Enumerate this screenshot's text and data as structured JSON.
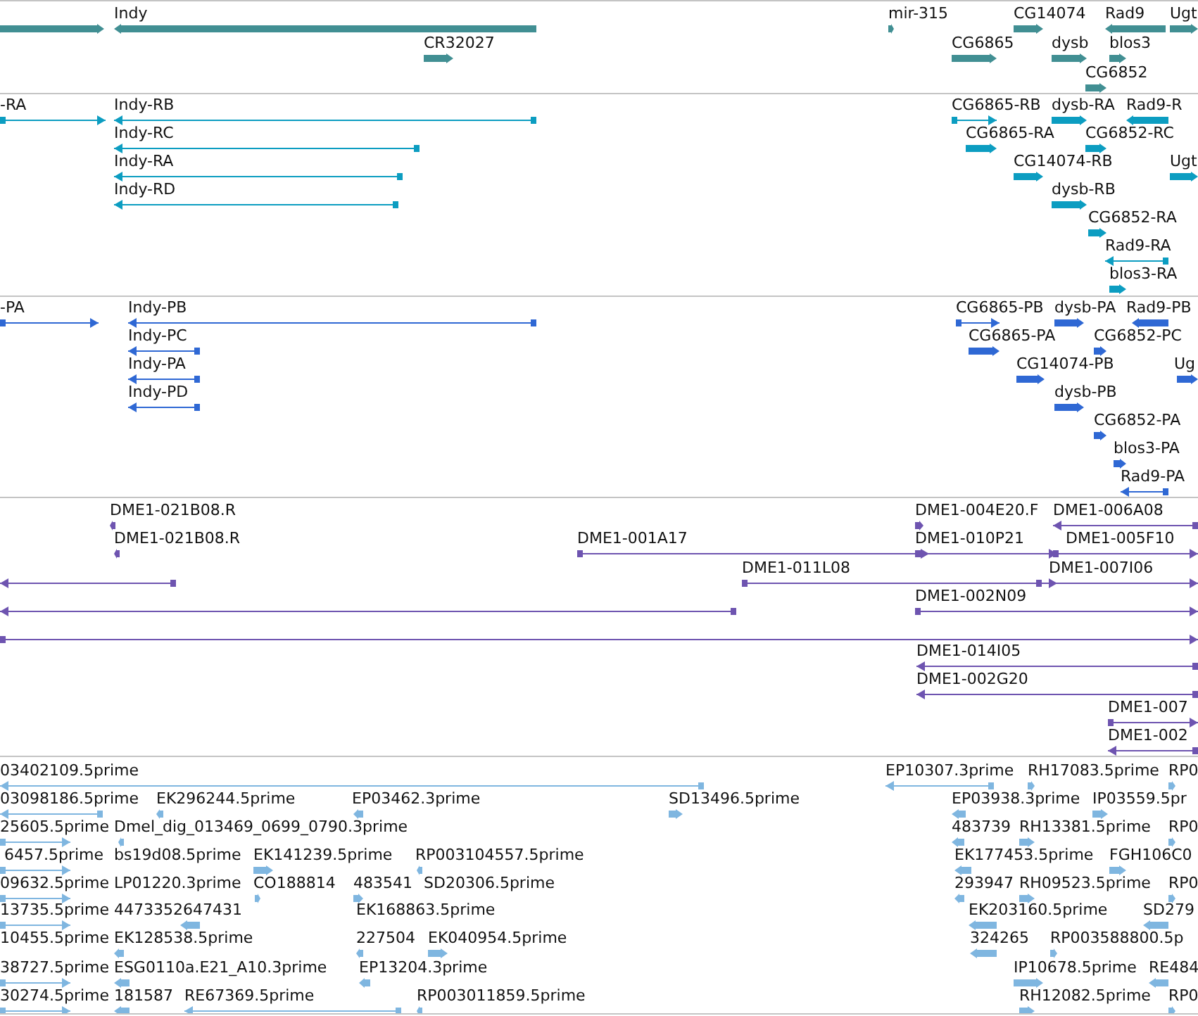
{
  "tracks": [
    {
      "kind": "gene",
      "features": [
        {
          "reverse": false
        },
        {
          "label": "Indy",
          "reverse": true
        },
        {
          "label": "mir-315",
          "reverse": false
        },
        {
          "label": "CG14074",
          "reverse": false
        },
        {
          "label": "Rad9",
          "reverse": true
        },
        {
          "label": "Ugt",
          "reverse": false
        },
        {
          "label": "CR32027",
          "reverse": false
        },
        {
          "label": "CG6865",
          "reverse": false
        },
        {
          "label": "dysb",
          "reverse": false
        },
        {
          "label": "blos3",
          "reverse": false
        },
        {
          "label": "CG6852",
          "reverse": false
        }
      ]
    },
    {
      "kind": "transcript",
      "features": [
        {
          "label": "-RA",
          "reverse": false
        },
        {
          "label": "Indy-RB",
          "reverse": true
        },
        {
          "label": "CG6865-RB",
          "reverse": false
        },
        {
          "label": "dysb-RA",
          "reverse": false
        },
        {
          "label": "Rad9-R",
          "reverse": true
        },
        {
          "label": "Indy-RC",
          "reverse": true
        },
        {
          "label": "CG6865-RA",
          "reverse": false
        },
        {
          "label": "CG6852-RC",
          "reverse": false
        },
        {
          "label": "Indy-RA",
          "reverse": true
        },
        {
          "label": "CG14074-RB",
          "reverse": false
        },
        {
          "label": "Ugt",
          "reverse": false
        },
        {
          "label": "Indy-RD",
          "reverse": true
        },
        {
          "label": "dysb-RB",
          "reverse": false
        },
        {
          "label": "CG6852-RA",
          "reverse": false
        },
        {
          "label": "Rad9-RA",
          "reverse": true
        },
        {
          "label": "blos3-RA",
          "reverse": false
        }
      ]
    },
    {
      "kind": "protein",
      "features": [
        {
          "label": "-PA",
          "reverse": false
        },
        {
          "label": "Indy-PB",
          "reverse": true
        },
        {
          "label": "CG6865-PB",
          "reverse": false
        },
        {
          "label": "dysb-PA",
          "reverse": false
        },
        {
          "label": "Rad9-PB",
          "reverse": true
        },
        {
          "label": "Indy-PC",
          "reverse": true
        },
        {
          "label": "CG6865-PA",
          "reverse": false
        },
        {
          "label": "CG6852-PC",
          "reverse": false
        },
        {
          "label": "Indy-PA",
          "reverse": true
        },
        {
          "label": "CG14074-PB",
          "reverse": false
        },
        {
          "label": "Ug",
          "reverse": false
        },
        {
          "label": "Indy-PD",
          "reverse": true
        },
        {
          "label": "dysb-PB",
          "reverse": false
        },
        {
          "label": "CG6852-PA",
          "reverse": false
        },
        {
          "label": "blos3-PA",
          "reverse": false
        },
        {
          "label": "Rad9-PA",
          "reverse": true
        }
      ]
    },
    {
      "kind": "clone",
      "features": [
        {
          "label": "DME1-021B08.R",
          "reverse": true
        },
        {
          "label": "DME1-004E20.F",
          "reverse": false
        },
        {
          "label": "DME1-006A08",
          "reverse": true
        },
        {
          "label": "DME1-021B08.R",
          "reverse": true
        },
        {
          "label": "DME1-001A17",
          "reverse": false
        },
        {
          "label": "DME1-010P21",
          "reverse": false
        },
        {
          "label": "DME1-005F10",
          "reverse": false
        },
        {
          "reverse": true
        },
        {
          "label": "DME1-011L08",
          "reverse": false
        },
        {
          "label": "DME1-007I06",
          "reverse": false
        },
        {
          "reverse": true
        },
        {
          "label": "DME1-002N09",
          "reverse": false
        },
        {
          "reverse": false
        },
        {
          "label": "DME1-014I05",
          "reverse": true
        },
        {
          "label": "DME1-002G20",
          "reverse": true
        },
        {
          "label": "DME1-007",
          "reverse": false
        },
        {
          "label": "DME1-002",
          "reverse": true
        }
      ]
    },
    {
      "kind": "est",
      "features": [
        {
          "label": "03402109.5prime",
          "reverse": true
        },
        {
          "label": "EP10307.3prime",
          "reverse": true
        },
        {
          "label": "RH17083.5prime",
          "reverse": false
        },
        {
          "label": "RP0",
          "reverse": false
        },
        {
          "label": "03098186.5prime",
          "reverse": true
        },
        {
          "label": "EK296244.5prime",
          "reverse": true
        },
        {
          "label": "EP03462.3prime",
          "reverse": true
        },
        {
          "label": "SD13496.5prime",
          "reverse": false
        },
        {
          "label": "EP03938.3prime",
          "reverse": true
        },
        {
          "label": "IP03559.5pr",
          "reverse": false
        },
        {
          "label": "25605.5prime",
          "reverse": false
        },
        {
          "label": "Dmel_dig_013469_0699_0790.3prime",
          "reverse": true
        },
        {
          "label": "483739",
          "reverse": true
        },
        {
          "label": "RH13381.5prime",
          "reverse": false
        },
        {
          "label": "RP0",
          "reverse": false
        },
        {
          "label": "6457.5prime",
          "reverse": false
        },
        {
          "label": "bs19d08.5prime"
        },
        {
          "label": "EK141239.5prime",
          "reverse": false
        },
        {
          "label": "RP003104557.5prime",
          "reverse": true
        },
        {
          "label": "EK177453.5prime",
          "reverse": true
        },
        {
          "label": "FGH106C0",
          "reverse": false
        },
        {
          "label": "09632.5prime",
          "reverse": false
        },
        {
          "label": "LP01220.3prime"
        },
        {
          "label": "CO188814",
          "reverse": false
        },
        {
          "label": "483541",
          "reverse": false
        },
        {
          "label": "SD20306.5prime"
        },
        {
          "label": "293947",
          "reverse": true
        },
        {
          "label": "RH09523.5prime",
          "reverse": false
        },
        {
          "label": "RP0",
          "reverse": false
        },
        {
          "label": "13735.5prime",
          "reverse": false
        },
        {
          "label": "4473352647431",
          "reverse": true
        },
        {
          "label": "EK168863.5prime"
        },
        {
          "label": "EK203160.5prime",
          "reverse": true
        },
        {
          "label": "SD279",
          "reverse": true
        },
        {
          "label": "10455.5prime"
        },
        {
          "label": "EK128538.5prime",
          "reverse": true
        },
        {
          "label": "227504",
          "reverse": true
        },
        {
          "label": "EK040954.5prime",
          "reverse": false
        },
        {
          "label": "324265",
          "reverse": true
        },
        {
          "label": "RP003588800.5p",
          "reverse": false
        },
        {
          "label": "38727.5prime",
          "reverse": false
        },
        {
          "label": "ESG0110a.E21_A10.3prime",
          "reverse": true
        },
        {
          "label": "EP13204.3prime",
          "reverse": true
        },
        {
          "label": "IP10678.5prime",
          "reverse": false
        },
        {
          "label": "RE484",
          "reverse": true
        },
        {
          "label": "30274.5prime",
          "reverse": false
        },
        {
          "label": "181587",
          "reverse": true
        },
        {
          "label": "RE67369.5prime",
          "reverse": true
        },
        {
          "label": "RP003011859.5prime",
          "reverse": true
        },
        {
          "label": "RH12082.5prime",
          "reverse": false
        },
        {
          "label": "RP0",
          "reverse": false
        }
      ]
    }
  ]
}
